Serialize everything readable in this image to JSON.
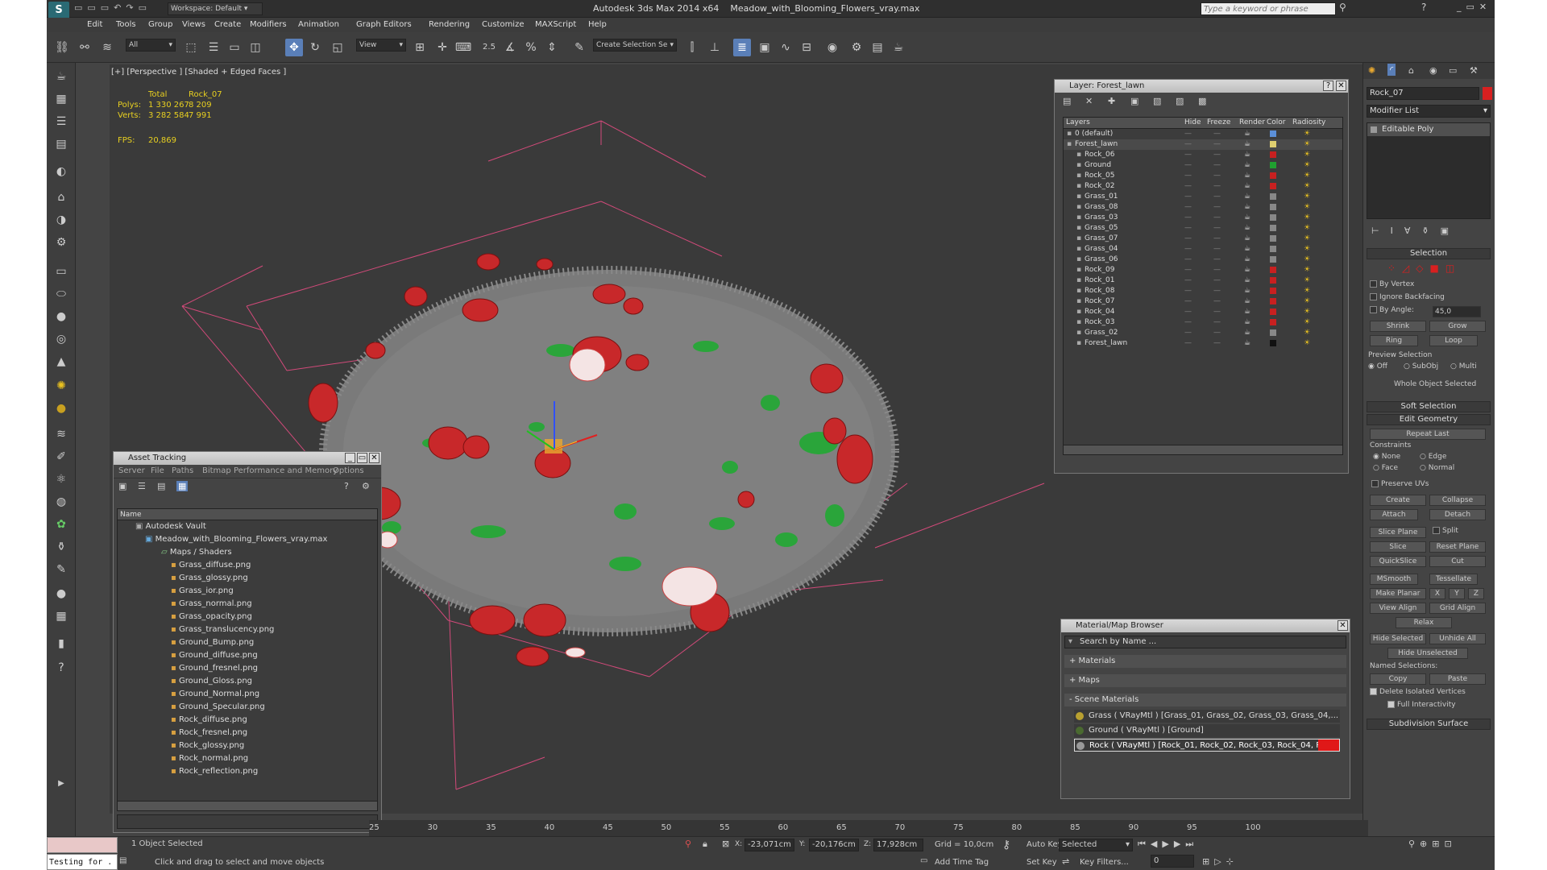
{
  "title": {
    "app": "Autodesk 3ds Max 2014 x64",
    "file": "Meadow_with_Blooming_Flowers_vray.max",
    "workspace": "Workspace: Default",
    "search_placeholder": "Type a keyword or phrase"
  },
  "menus": [
    "Edit",
    "Tools",
    "Group",
    "Views",
    "Create",
    "Modifiers",
    "Animation",
    "Graph Editors",
    "Rendering",
    "Customize",
    "MAXScript",
    "Help"
  ],
  "toolbar": {
    "filter": "All",
    "refcoord": "View",
    "selset": "Create Selection Se",
    "snap": "2.5"
  },
  "viewport": {
    "label": "[+] [Perspective ] [Shaded + Edged Faces ]",
    "stats_hdr_total": "Total",
    "stats_hdr_obj": "Rock_07",
    "polys_label": "Polys:",
    "polys_total": "1 330 267",
    "polys_obj": "8 209",
    "verts_label": "Verts:",
    "verts_total": "3 282 584",
    "verts_obj": "7 991",
    "fps_label": "FPS:",
    "fps": "20,869"
  },
  "layer": {
    "title": "Layer: Forest_lawn",
    "columns": [
      "Layers",
      "Hide",
      "Freeze",
      "Render",
      "Color",
      "Radiosity"
    ],
    "rows": [
      {
        "name": "0 (default)",
        "color": "#5b8fd8"
      },
      {
        "name": "Forest_lawn",
        "color": "#e0d070"
      },
      {
        "name": "Rock_06",
        "color": "#c82020"
      },
      {
        "name": "Ground",
        "color": "#20a030"
      },
      {
        "name": "Rock_05",
        "color": "#c82020"
      },
      {
        "name": "Rock_02",
        "color": "#c82020"
      },
      {
        "name": "Grass_01",
        "color": "#888888"
      },
      {
        "name": "Grass_08",
        "color": "#888888"
      },
      {
        "name": "Grass_03",
        "color": "#888888"
      },
      {
        "name": "Grass_05",
        "color": "#888888"
      },
      {
        "name": "Grass_07",
        "color": "#888888"
      },
      {
        "name": "Grass_04",
        "color": "#888888"
      },
      {
        "name": "Grass_06",
        "color": "#888888"
      },
      {
        "name": "Rock_09",
        "color": "#c82020"
      },
      {
        "name": "Rock_01",
        "color": "#c82020"
      },
      {
        "name": "Rock_08",
        "color": "#c82020"
      },
      {
        "name": "Rock_07",
        "color": "#c82020"
      },
      {
        "name": "Rock_04",
        "color": "#c82020"
      },
      {
        "name": "Rock_03",
        "color": "#c82020"
      },
      {
        "name": "Grass_02",
        "color": "#888888"
      },
      {
        "name": "Forest_lawn",
        "color": "#111111"
      }
    ]
  },
  "asset": {
    "title": "Asset Tracking",
    "menus": [
      "Server",
      "File",
      "Paths",
      "Bitmap Performance and Memory",
      "Options"
    ],
    "col": "Name",
    "vault": "Autodesk Vault",
    "file": "Meadow_with_Blooming_Flowers_vray.max",
    "maps": "Maps / Shaders",
    "files": [
      "Grass_diffuse.png",
      "Grass_glossy.png",
      "Grass_ior.png",
      "Grass_normal.png",
      "Grass_opacity.png",
      "Grass_translucency.png",
      "Ground_Bump.png",
      "Ground_diffuse.png",
      "Ground_fresnel.png",
      "Ground_Gloss.png",
      "Ground_Normal.png",
      "Ground_Specular.png",
      "Rock_diffuse.png",
      "Rock_fresnel.png",
      "Rock_glossy.png",
      "Rock_normal.png",
      "Rock_reflection.png"
    ]
  },
  "material": {
    "title": "Material/Map Browser",
    "search": "Search by Name ...",
    "sections": [
      "+ Materials",
      "+ Maps",
      "- Scene Materials"
    ],
    "items": [
      "Grass  ( VRayMtl ) [Grass_01, Grass_02, Grass_03, Grass_04,...",
      "Ground  ( VRayMtl ) [Ground]",
      "Rock  ( VRayMtl ) [Rock_01, Rock_02, Rock_03, Rock_04, Roc..."
    ]
  },
  "cmd": {
    "object": "Rock_07",
    "modlist": "Modifier List",
    "modifier": "Editable Poly",
    "selection": "Selection",
    "by_vertex": "By Vertex",
    "ignore_backfacing": "Ignore Backfacing",
    "by_angle": "By Angle:",
    "angle": "45,0",
    "shrink": "Shrink",
    "grow": "Grow",
    "ring": "Ring",
    "loop": "Loop",
    "preview": "Preview Selection",
    "off": "Off",
    "subobj": "SubObj",
    "multi": "Multi",
    "whole": "Whole Object Selected",
    "soft": "Soft Selection",
    "editgeo": "Edit Geometry",
    "repeat": "Repeat Last",
    "constraints": "Constraints",
    "none": "None",
    "edge": "Edge",
    "face": "Face",
    "normal": "Normal",
    "preserve": "Preserve UVs",
    "create": "Create",
    "collapse": "Collapse",
    "attach": "Attach",
    "detach": "Detach",
    "slice_plane": "Slice Plane",
    "split": "Split",
    "slice": "Slice",
    "reset_plane": "Reset Plane",
    "quickslice": "QuickSlice",
    "cut": "Cut",
    "msmooth": "MSmooth",
    "tessellate": "Tessellate",
    "make_planar": "Make Planar",
    "x": "X",
    "y": "Y",
    "z": "Z",
    "view_align": "View Align",
    "grid_align": "Grid Align",
    "relax": "Relax",
    "hide_sel": "Hide Selected",
    "unhide": "Unhide All",
    "hide_unsel": "Hide Unselected",
    "named": "Named Selections:",
    "copy": "Copy",
    "paste": "Paste",
    "delete_iso": "Delete Isolated Vertices",
    "full_inter": "Full Interactivity",
    "subdiv": "Subdivision Surface"
  },
  "timeline": {
    "ticks": [
      "25",
      "30",
      "35",
      "40",
      "45",
      "50",
      "55",
      "60",
      "65",
      "70",
      "75",
      "80",
      "85",
      "90",
      "95",
      "100"
    ]
  },
  "status": {
    "listener": "Testing for .",
    "selected": "1 Object Selected",
    "prompt": "Click and drag to select and move objects",
    "x_label": "X:",
    "x": "-23,071cm",
    "y_label": "Y:",
    "y": "-20,176cm",
    "z_label": "Z:",
    "z": "17,928cm",
    "grid": "Grid = 10,0cm",
    "autokey": "Auto Key",
    "setkey": "Set Key",
    "sel_combo": "Selected",
    "keyfilters": "Key Filters...",
    "frame": "0",
    "add_time_tag": "Add Time Tag"
  }
}
